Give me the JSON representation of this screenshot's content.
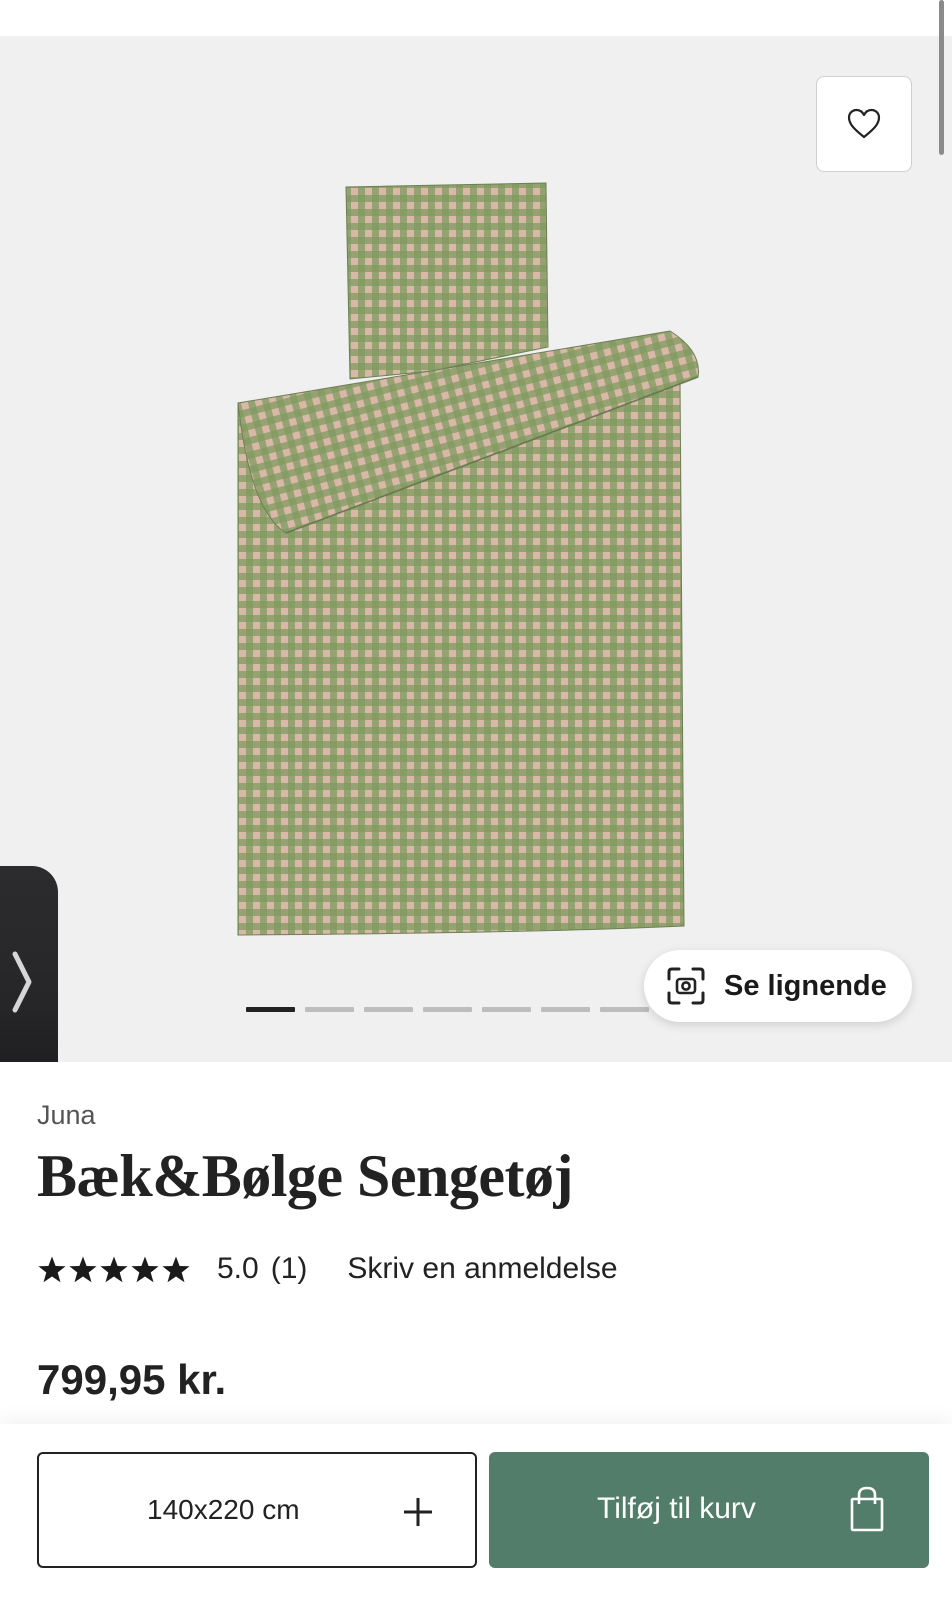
{
  "gallery": {
    "wishlist_icon": "heart-outline-icon",
    "similar_button": {
      "label": "Se lignende",
      "icon": "visual-search-icon"
    },
    "pagination": {
      "count": 8,
      "active_index": 0
    },
    "side_tab_icon": "chevron-right-icon",
    "product_colors": {
      "green": "#7a9258",
      "pink": "#d8b4a3"
    }
  },
  "product": {
    "brand": "Juna",
    "title": "Bæk&Bølge Sengetøj",
    "rating": {
      "stars": 5,
      "value": "5.0",
      "count": "(1)"
    },
    "review_link": "Skriv en anmeldelse",
    "price": "799,95 kr."
  },
  "actions": {
    "size_select": {
      "value": "140x220 cm",
      "icon": "plus-icon"
    },
    "add_to_cart": {
      "label": "Tilføj til kurv",
      "icon": "shopping-bag-icon",
      "color": "#527d6b"
    }
  }
}
